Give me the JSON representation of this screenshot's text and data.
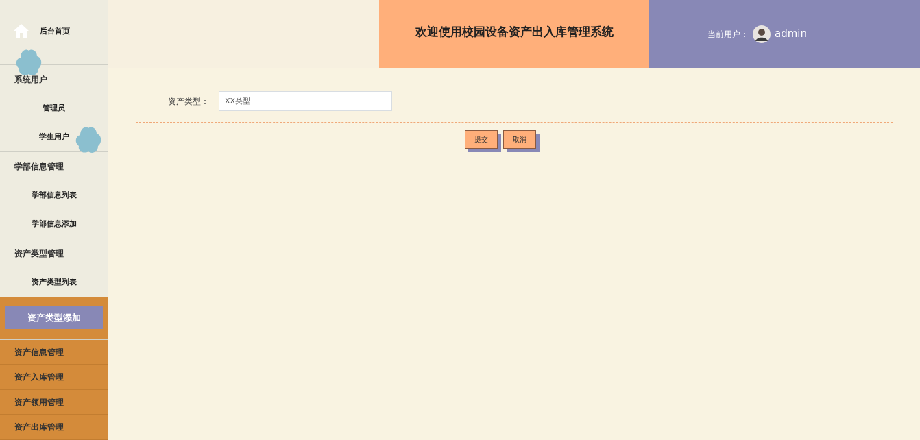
{
  "sidebar": {
    "home": {
      "label": "后台首页"
    },
    "groups": [
      {
        "title": "系统用户",
        "children": [
          {
            "label": "管理员",
            "selected": false
          },
          {
            "label": "学生用户",
            "selected": false
          }
        ]
      },
      {
        "title": "学部信息管理",
        "children": [
          {
            "label": "学部信息列表",
            "selected": false
          },
          {
            "label": "学部信息添加",
            "selected": false
          }
        ]
      },
      {
        "title": "资产类型管理",
        "children": [
          {
            "label": "资产类型列表",
            "selected": false
          },
          {
            "label": "资产类型添加",
            "selected": true
          }
        ]
      },
      {
        "title": "资产信息管理"
      },
      {
        "title": "资产入库管理"
      },
      {
        "title": "资产领用管理"
      },
      {
        "title": "资产出库管理"
      }
    ]
  },
  "header": {
    "title": "欢迎使用校园设备资产出入库管理系统",
    "user_label": "当前用户：",
    "username": "admin"
  },
  "form": {
    "fields": [
      {
        "label": "资产类型：",
        "value": "XX类型"
      }
    ],
    "buttons": [
      "提交",
      "取消"
    ]
  }
}
